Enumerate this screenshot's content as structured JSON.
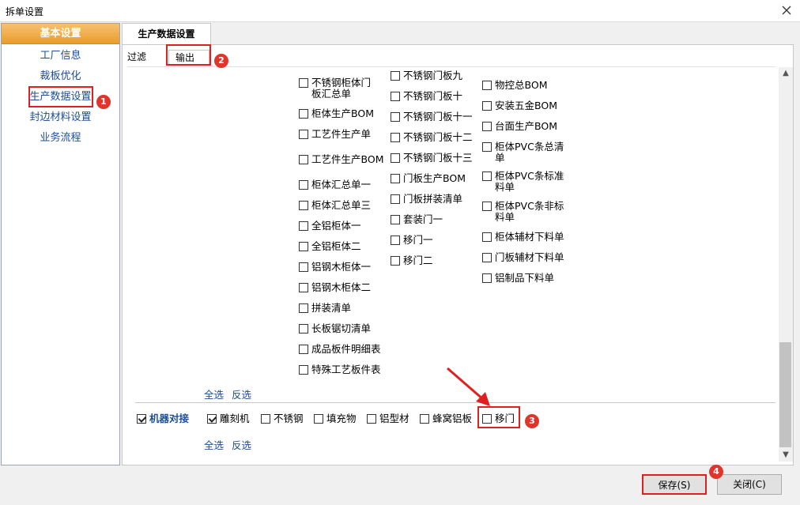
{
  "window": {
    "title": "拆单设置"
  },
  "sidebar": {
    "header": "基本设置",
    "items": [
      {
        "label": "工厂信息"
      },
      {
        "label": "裁板优化"
      },
      {
        "label": "生产数据设置"
      },
      {
        "label": "封边材料设置"
      },
      {
        "label": "业务流程"
      }
    ]
  },
  "tabs": {
    "main": "生产数据设置",
    "sub": [
      "过滤",
      "输出"
    ]
  },
  "output_reports": {
    "col1": [
      {
        "label": "不锈钢柜体门\n板汇总单",
        "checked": false
      },
      {
        "label": "柜体生产BOM",
        "checked": false
      },
      {
        "label": "工艺件生产单",
        "checked": false
      },
      {
        "label": "工艺件生产BOM",
        "checked": false
      },
      {
        "label": "柜体汇总单一",
        "checked": false
      },
      {
        "label": "柜体汇总单三",
        "checked": false
      },
      {
        "label": "全铝柜体一",
        "checked": false
      },
      {
        "label": "全铝柜体二",
        "checked": false
      },
      {
        "label": "铝钢木柜体一",
        "checked": false
      },
      {
        "label": "铝钢木柜体二",
        "checked": false
      },
      {
        "label": "拼装清单",
        "checked": false
      },
      {
        "label": "长板锯切清单",
        "checked": false
      },
      {
        "label": "成品板件明细表",
        "checked": false
      },
      {
        "label": "特殊工艺板件表",
        "checked": false
      }
    ],
    "col2": [
      {
        "label": "不锈钢门板九",
        "checked": false
      },
      {
        "label": "不锈钢门板十",
        "checked": false
      },
      {
        "label": "不锈钢门板十一",
        "checked": false
      },
      {
        "label": "不锈钢门板十二",
        "checked": false
      },
      {
        "label": "不锈钢门板十三",
        "checked": false
      },
      {
        "label": "门板生产BOM",
        "checked": false
      },
      {
        "label": "门板拼装清单",
        "checked": false
      },
      {
        "label": "套装门一",
        "checked": false
      },
      {
        "label": "移门一",
        "checked": false
      },
      {
        "label": "移门二",
        "checked": false
      }
    ],
    "col3": [
      {
        "label": "物控总BOM",
        "checked": false
      },
      {
        "label": "安装五金BOM",
        "checked": false
      },
      {
        "label": "台面生产BOM",
        "checked": false
      },
      {
        "label": "柜体PVC条总清\n单",
        "checked": false
      },
      {
        "label": "柜体PVC条标准\n料单",
        "checked": false
      },
      {
        "label": "柜体PVC条非标\n料单",
        "checked": false
      },
      {
        "label": "柜体辅材下料单",
        "checked": false
      },
      {
        "label": "门板辅材下料单",
        "checked": false
      },
      {
        "label": "铝制品下料单",
        "checked": false
      }
    ],
    "select_all": "全选",
    "invert": "反选"
  },
  "machine_docking": {
    "label": "机器对接",
    "checked": true,
    "options": [
      {
        "label": "雕刻机",
        "checked": true
      },
      {
        "label": "不锈钢",
        "checked": false
      },
      {
        "label": "填充物",
        "checked": false
      },
      {
        "label": "铝型材",
        "checked": false
      },
      {
        "label": "蜂窝铝板",
        "checked": false
      },
      {
        "label": "移门",
        "checked": false
      }
    ],
    "select_all": "全选",
    "invert": "反选"
  },
  "buttons": {
    "save": "保存(S)",
    "close": "关闭(C)"
  },
  "markers": [
    "1",
    "2",
    "3",
    "4"
  ],
  "colors": {
    "highlight": "#e02020",
    "marker": "#e0352b",
    "link": "#1c4f98",
    "sidebar_header": "#e99d2c"
  }
}
